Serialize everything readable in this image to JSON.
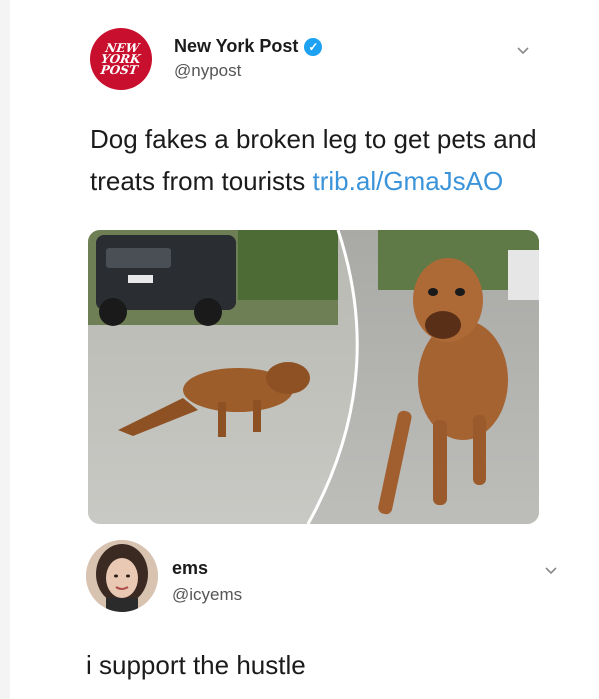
{
  "tweet": {
    "author_name": "New York Post",
    "author_handle": "@nypost",
    "avatar_logo_text": "NEW YORK POST",
    "verified": true,
    "text_main": "Dog fakes a broken leg to get pets and treats from tourists",
    "link_text": "trib.al/GmaJsAO",
    "menu_icon": "chevron-down-icon",
    "accent_color": "#3b94d9",
    "brand_color": "#c8102e"
  },
  "reply": {
    "author_name": "ems",
    "author_handle": "@icyems",
    "text": "i support the hustle",
    "menu_icon": "chevron-down-icon"
  }
}
